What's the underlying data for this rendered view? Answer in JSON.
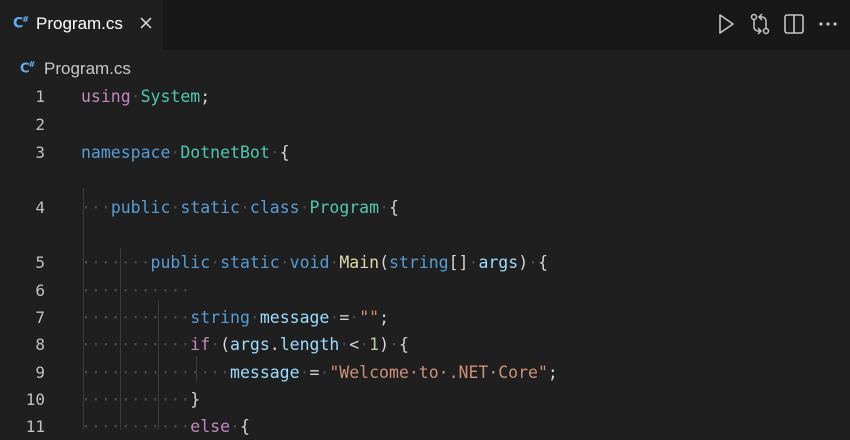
{
  "tab": {
    "icon": "csharp-file-icon",
    "icon_text": "C#",
    "title": "Program.cs",
    "close_icon": "close-icon"
  },
  "actions": [
    {
      "name": "run-button",
      "icon": "play-icon"
    },
    {
      "name": "compare-changes-button",
      "icon": "git-compare-icon"
    },
    {
      "name": "split-editor-button",
      "icon": "split-editor-icon"
    },
    {
      "name": "more-actions-button",
      "icon": "ellipsis-icon"
    }
  ],
  "breadcrumb": {
    "icon": "csharp-file-icon",
    "icon_text": "C#",
    "label": "Program.cs"
  },
  "colors": {
    "background": "#1f1f1f",
    "tabbar": "#181818",
    "keyword": "#569cd6",
    "control": "#c586c0",
    "type": "#4ec9b0",
    "function": "#dcdcaa",
    "variable": "#9cdcfe",
    "string": "#ce9178",
    "number": "#b5cea8"
  },
  "lines": [
    {
      "n": "1",
      "indent": 0,
      "tokens": [
        [
          "ctl",
          "using"
        ],
        [
          "ws",
          "·"
        ],
        [
          "type",
          "System"
        ],
        [
          "plain",
          ";"
        ]
      ]
    },
    {
      "n": "2",
      "indent": 0,
      "tokens": []
    },
    {
      "n": "3",
      "indent": 0,
      "tokens": [
        [
          "kw",
          "namespace"
        ],
        [
          "ws",
          "·"
        ],
        [
          "type",
          "DotnetBot"
        ],
        [
          "ws",
          "·"
        ],
        [
          "plain",
          "{"
        ]
      ]
    },
    {
      "n": "4",
      "indent": 1,
      "tokens": [
        [
          "ws",
          "···"
        ],
        [
          "kw",
          "public"
        ],
        [
          "ws",
          "·"
        ],
        [
          "kw",
          "static"
        ],
        [
          "ws",
          "·"
        ],
        [
          "kw",
          "class"
        ],
        [
          "ws",
          "·"
        ],
        [
          "type",
          "Program"
        ],
        [
          "ws",
          "·"
        ],
        [
          "plain",
          "{"
        ]
      ]
    },
    {
      "n": "5",
      "indent": 2,
      "tokens": [
        [
          "ws",
          "·······"
        ],
        [
          "kw",
          "public"
        ],
        [
          "ws",
          "·"
        ],
        [
          "kw",
          "static"
        ],
        [
          "ws",
          "·"
        ],
        [
          "kw",
          "void"
        ],
        [
          "ws",
          "·"
        ],
        [
          "fn",
          "Main"
        ],
        [
          "plain",
          "("
        ],
        [
          "kw",
          "string"
        ],
        [
          "plain",
          "[]"
        ],
        [
          "ws",
          "·"
        ],
        [
          "var",
          "args"
        ],
        [
          "plain",
          ")"
        ],
        [
          "ws",
          "·"
        ],
        [
          "plain",
          "{"
        ]
      ]
    },
    {
      "n": "6",
      "indent": 2,
      "tokens": [
        [
          "ws",
          "···········"
        ]
      ]
    },
    {
      "n": "7",
      "indent": 3,
      "tokens": [
        [
          "ws",
          "···········"
        ],
        [
          "kw",
          "string"
        ],
        [
          "ws",
          "·"
        ],
        [
          "var",
          "message"
        ],
        [
          "ws",
          "·"
        ],
        [
          "plain",
          "="
        ],
        [
          "ws",
          "·"
        ],
        [
          "str",
          "\"\""
        ],
        [
          "plain",
          ";"
        ]
      ]
    },
    {
      "n": "8",
      "indent": 3,
      "tokens": [
        [
          "ws",
          "···········"
        ],
        [
          "ctl",
          "if"
        ],
        [
          "ws",
          "·"
        ],
        [
          "plain",
          "("
        ],
        [
          "var",
          "args"
        ],
        [
          "plain",
          "."
        ],
        [
          "var",
          "length"
        ],
        [
          "ws",
          "·"
        ],
        [
          "plain",
          "<"
        ],
        [
          "ws",
          "·"
        ],
        [
          "num",
          "1"
        ],
        [
          "plain",
          ")"
        ],
        [
          "ws",
          "·"
        ],
        [
          "plain",
          "{"
        ]
      ]
    },
    {
      "n": "9",
      "indent": 4,
      "tokens": [
        [
          "ws",
          "···············"
        ],
        [
          "var",
          "message"
        ],
        [
          "ws",
          "·"
        ],
        [
          "plain",
          "="
        ],
        [
          "ws",
          "·"
        ],
        [
          "str",
          "\"Welcome·to·.NET·Core\""
        ],
        [
          "plain",
          ";"
        ]
      ]
    },
    {
      "n": "10",
      "indent": 3,
      "tokens": [
        [
          "ws",
          "···········"
        ],
        [
          "plain",
          "}"
        ]
      ]
    },
    {
      "n": "11",
      "indent": 3,
      "tokens": [
        [
          "ws",
          "···········"
        ],
        [
          "ctl",
          "else"
        ],
        [
          "ws",
          "·"
        ],
        [
          "plain",
          "{"
        ]
      ]
    }
  ]
}
